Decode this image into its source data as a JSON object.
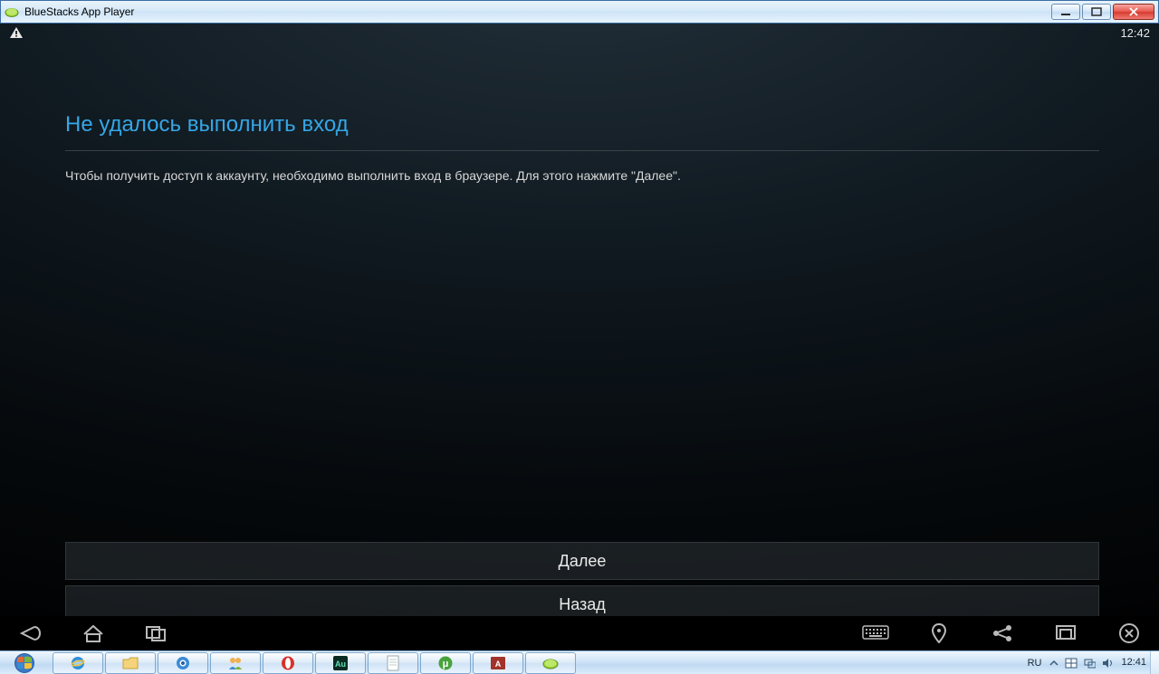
{
  "window": {
    "title": "BlueStacks App Player"
  },
  "statusbar": {
    "time": "12:42"
  },
  "dialog": {
    "title": "Не удалось выполнить вход",
    "message": "Чтобы получить доступ к аккаунту, необходимо выполнить вход в браузере. Для этого нажмите \"Далее\".",
    "next": "Далее",
    "back": "Назад"
  },
  "taskbar": {
    "lang": "RU",
    "clock_time": "12:41"
  }
}
